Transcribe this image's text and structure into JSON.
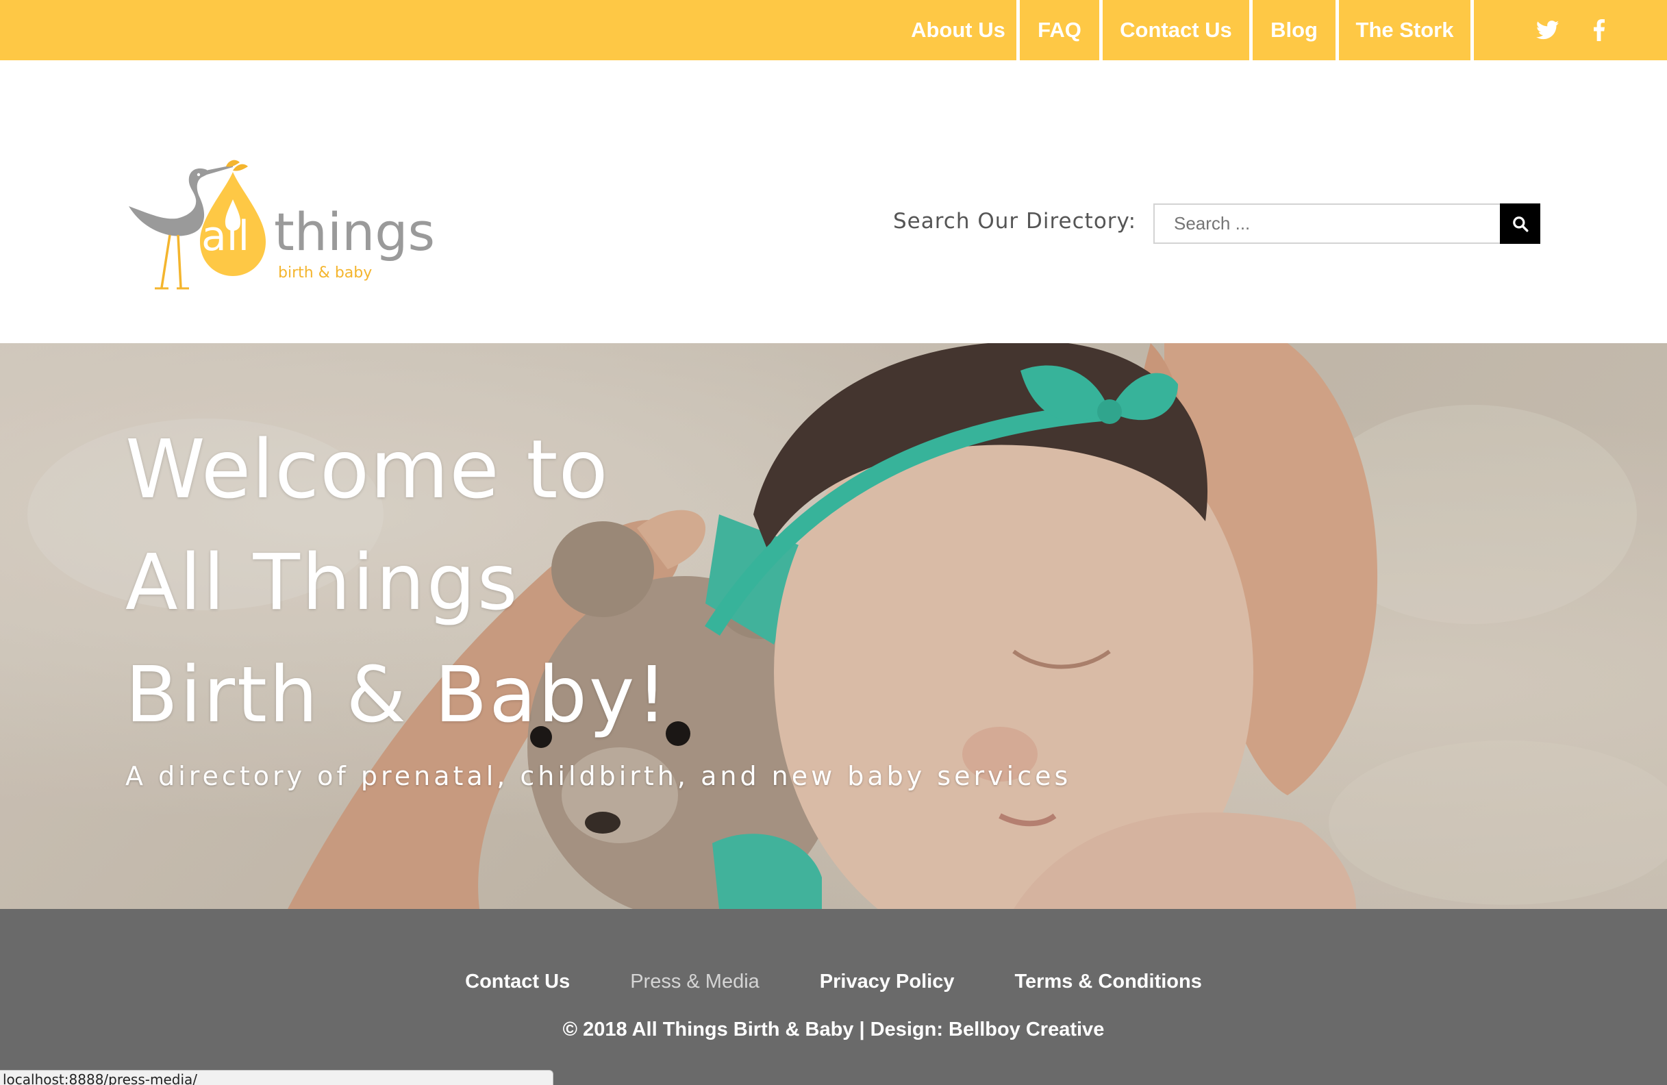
{
  "colors": {
    "brand_yellow": "#fec845",
    "footer_gray": "#6a6a6a",
    "stork_gray": "#9a9a9a",
    "bow_teal": "#3cc3a8"
  },
  "topnav": {
    "items": [
      {
        "label": "About Us"
      },
      {
        "label": "FAQ"
      },
      {
        "label": "Contact Us"
      },
      {
        "label": "Blog"
      },
      {
        "label": "The Stork"
      }
    ],
    "social": [
      "twitter-icon",
      "facebook-icon"
    ]
  },
  "logo": {
    "word1": "all",
    "word2": "things",
    "tagline": "birth & baby"
  },
  "search": {
    "label": "Search Our Directory:",
    "placeholder": "Search ...",
    "value": ""
  },
  "hero": {
    "welcome": "Welcome to",
    "title_line1": "All Things",
    "title_line2": "Birth & Baby!",
    "subtitle": "A directory of prenatal, childbirth, and new baby services"
  },
  "footer": {
    "links": [
      {
        "label": "Contact Us"
      },
      {
        "label": "Press & Media"
      },
      {
        "label": "Privacy Policy"
      },
      {
        "label": "Terms & Conditions"
      }
    ],
    "copyright": "© 2018 All Things Birth & Baby | Design: Bellboy Creative"
  },
  "status_bar": {
    "url": "localhost:8888/press-media/"
  }
}
